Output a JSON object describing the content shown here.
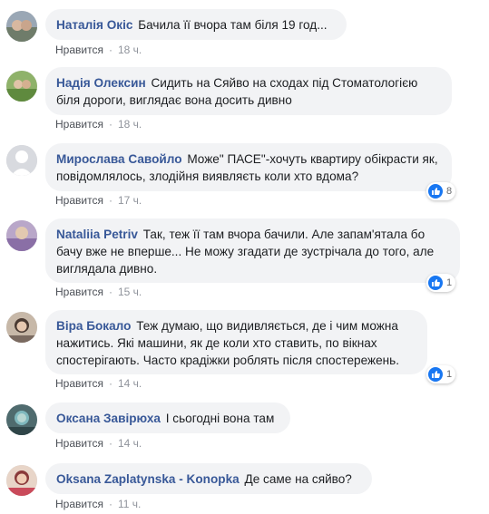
{
  "like_label": "Нравится",
  "comments": [
    {
      "author": "Наталія Окіс",
      "text": "Бачила її вчора там біля 19 год...",
      "time": "18 ч."
    },
    {
      "author": "Надія Олексин",
      "text": "Сидить на Сяйво на сходах під Стоматологією біля дороги, виглядає вона досить дивно",
      "time": "18 ч."
    },
    {
      "author": "Мирослава Савойло",
      "text": "Може\" ПАСЕ\"-хочуть квартиру обікрасти як, повідомлялось, злодійня виявляєть коли хто вдома?",
      "time": "17 ч.",
      "reactions": "8"
    },
    {
      "author": "Nataliia Petriv",
      "text": "Так, теж її там вчора бачили. Але запам'ятала бо бачу вже не вперше... Не можу згадати де зустрічала до того, але виглядала дивно.",
      "time": "15 ч.",
      "reactions": "1"
    },
    {
      "author": "Віра Бокало",
      "text": "Теж думаю, що видивляється, де і чим можна нажитись. Які машини, як де коли хто ставить, по вікнах спостерігають. Часто крадіжки роблять після спостережень.",
      "time": "14 ч.",
      "reactions": "1"
    },
    {
      "author": "Оксана Завірюха",
      "text": "І сьогодні вона там",
      "time": "14 ч."
    },
    {
      "author": "Oksana Zaplatynska - Konopka",
      "text": "Де саме на сяйво?",
      "time": "11 ч."
    }
  ]
}
